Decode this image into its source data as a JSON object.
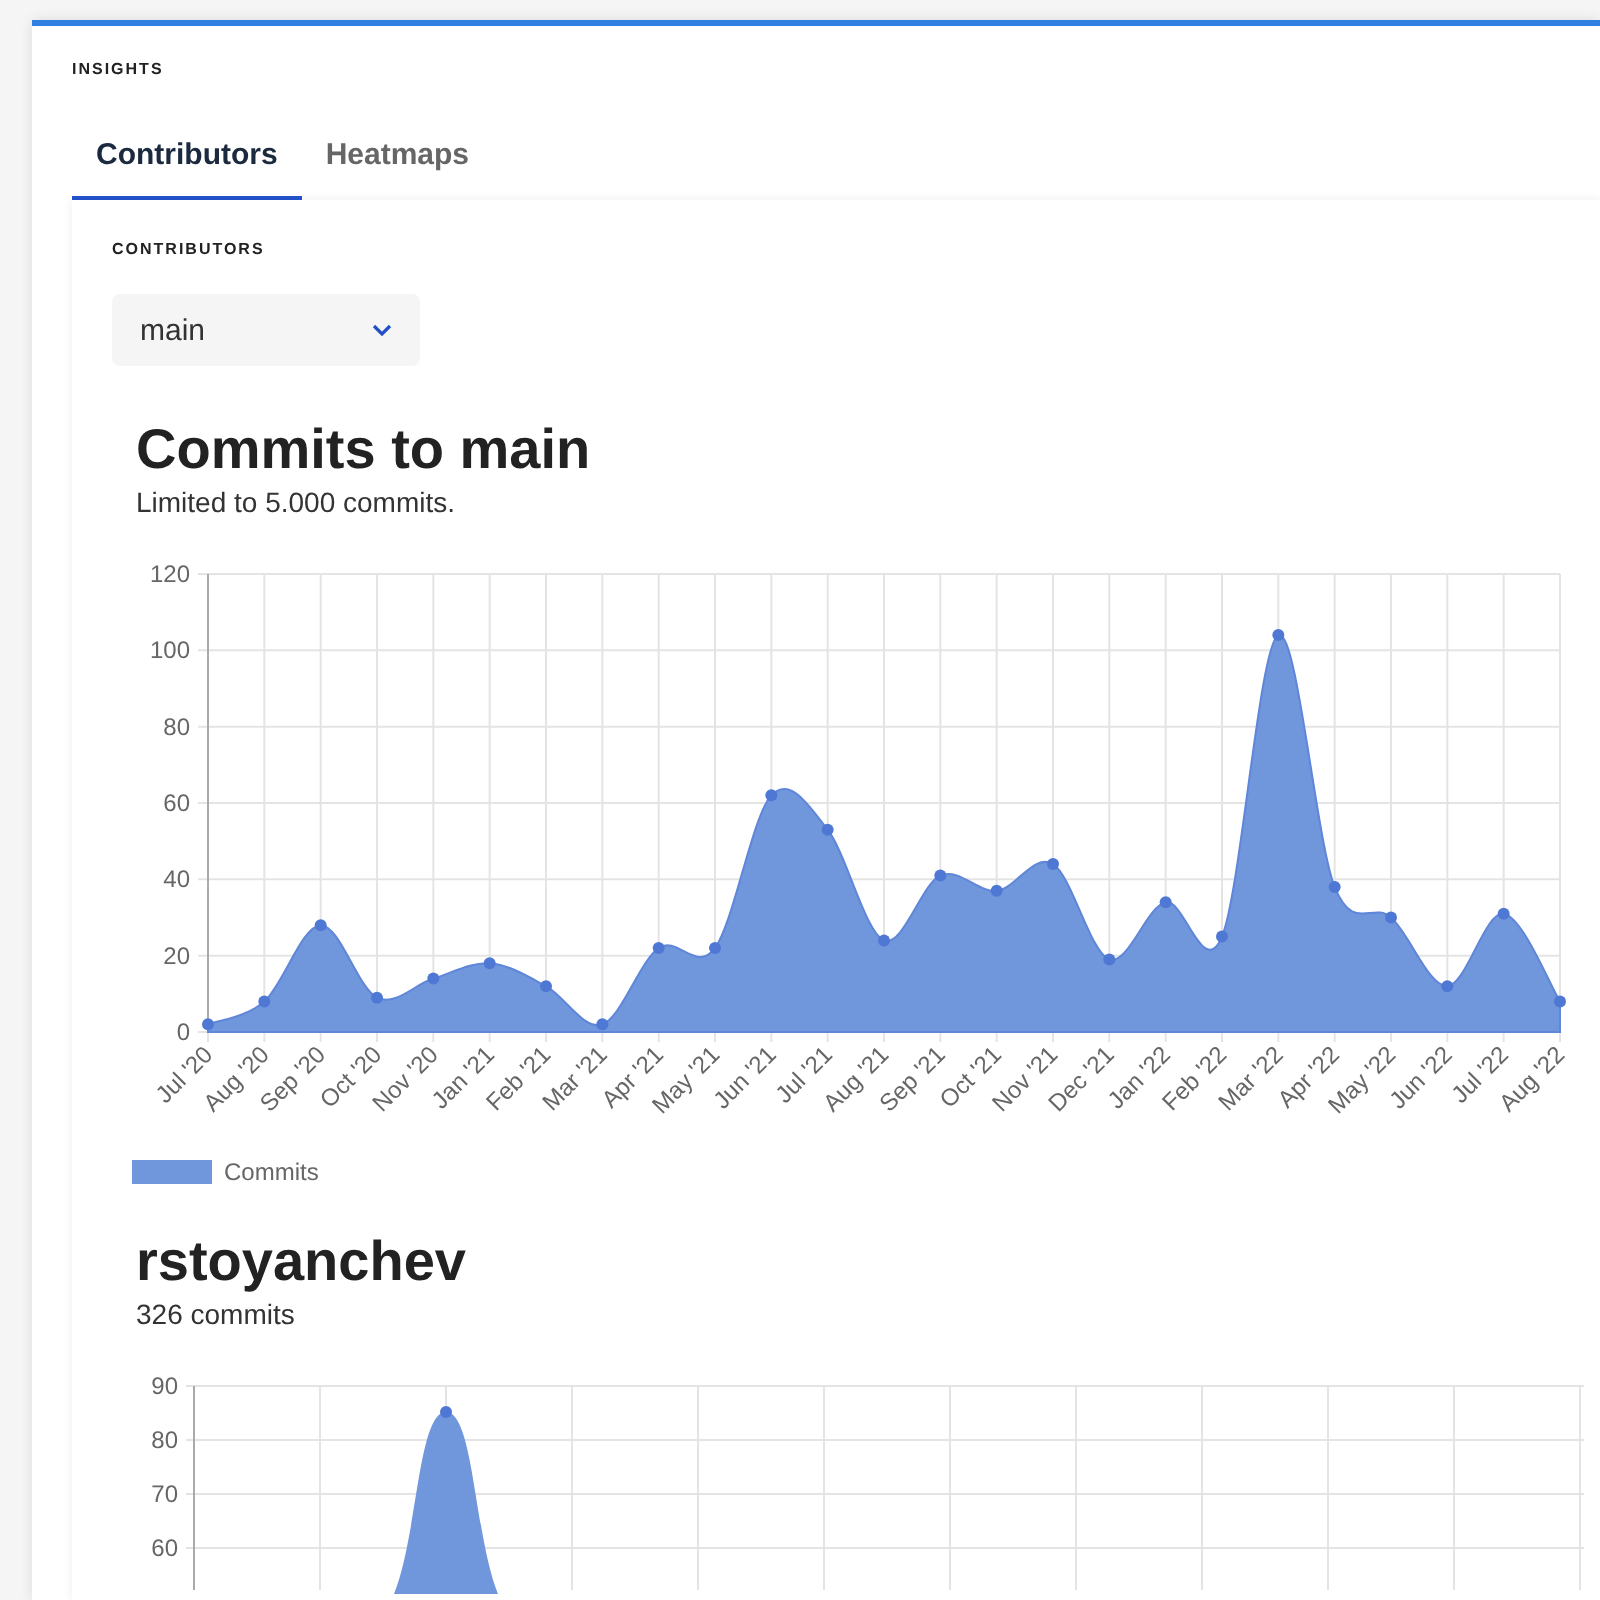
{
  "section_title": "INSIGHTS",
  "tabs": [
    {
      "label": "Contributors",
      "selected": true
    },
    {
      "label": "Heatmaps",
      "selected": false
    }
  ],
  "panel": {
    "title": "CONTRIBUTORS",
    "branch_select": {
      "value": "main"
    },
    "main_chart": {
      "heading": "Commits to main",
      "subtitle": "Limited to 5.000 commits.",
      "chart_data": {
        "type": "area",
        "categories": [
          "Jul '20",
          "Aug '20",
          "Sep '20",
          "Oct '20",
          "Nov '20",
          "Jan '21",
          "Feb '21",
          "Mar '21",
          "Apr '21",
          "May '21",
          "Jun '21",
          "Jul '21",
          "Aug '21",
          "Sep '21",
          "Oct '21",
          "Nov '21",
          "Dec '21",
          "Jan '22",
          "Feb '22",
          "Mar '22",
          "Apr '22",
          "May '22",
          "Jun '22",
          "Jul '22",
          "Aug '22"
        ],
        "series": [
          {
            "name": "Commits",
            "color": "#7096db",
            "values": [
              2,
              8,
              28,
              9,
              14,
              18,
              12,
              2,
              22,
              22,
              62,
              53,
              24,
              41,
              37,
              44,
              19,
              34,
              25,
              104,
              38,
              30,
              12,
              31,
              8
            ]
          }
        ],
        "ylim": [
          0,
          120
        ],
        "yticks": [
          0,
          20,
          40,
          60,
          80,
          100,
          120
        ],
        "grid": true
      }
    },
    "contributor": {
      "name": "rstoyanchev",
      "commits": "326 commits",
      "chart_axis_labels": [
        "90",
        "80",
        "70",
        "60"
      ]
    }
  }
}
